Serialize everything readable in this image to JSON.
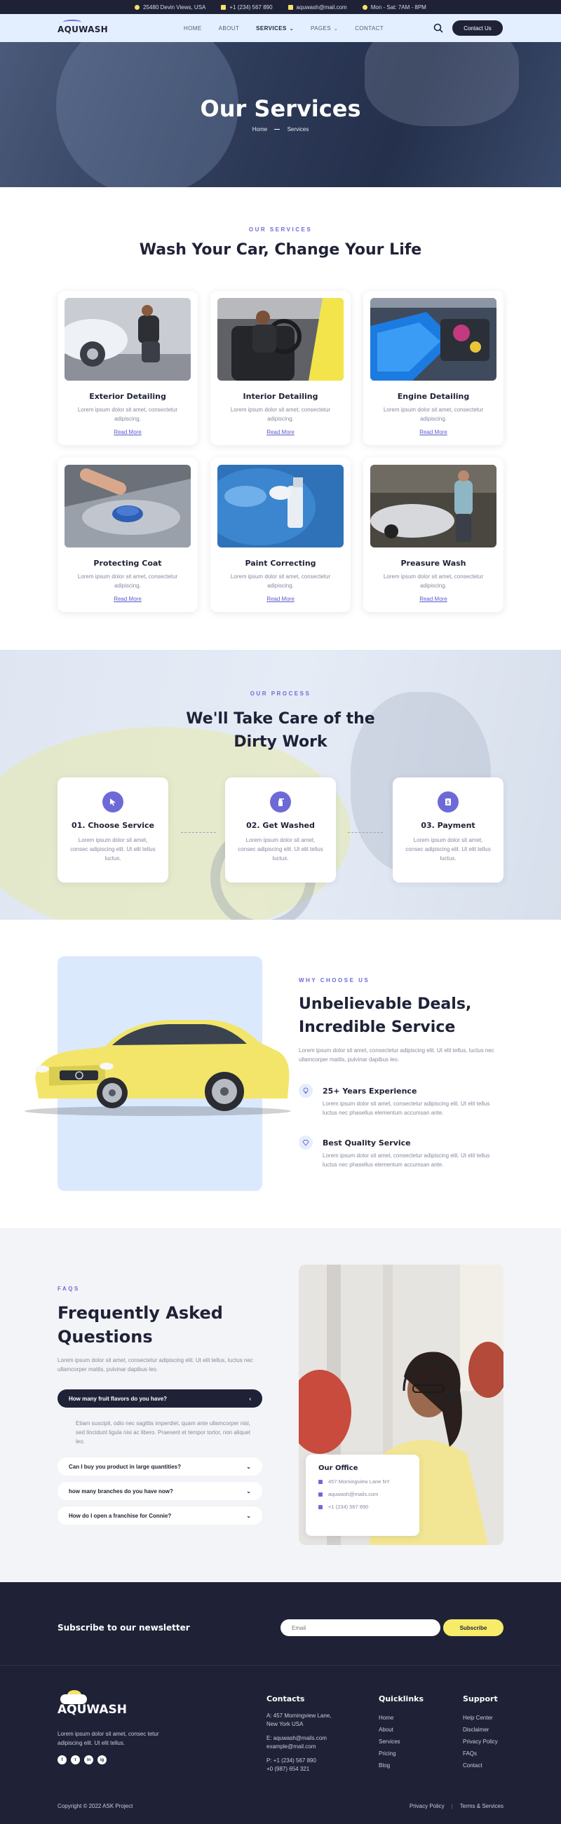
{
  "topbar": {
    "address": "25480 Devin Views, USA",
    "phone": "+1 (234) 567 890",
    "email": "aquwash@mail.com",
    "hours": "Mon - Sat: 7AM - 8PM"
  },
  "nav": {
    "logo": "AQUWASH",
    "items": [
      {
        "label": "HOME"
      },
      {
        "label": "ABOUT"
      },
      {
        "label": "SERVICES"
      },
      {
        "label": "PAGES"
      },
      {
        "label": "CONTACT"
      }
    ],
    "cta": "Contact Us"
  },
  "hero": {
    "title": "Our Services",
    "crumb_home": "Home",
    "crumb_current": "Services"
  },
  "services": {
    "eyebrow": "OUR SERVICES",
    "title": "Wash Your Car, Change Your Life",
    "cards": [
      {
        "title": "Exterior Detailing",
        "text": "Lorem ipsum dolor sit amet, consectetur adipiscing.",
        "link": "Read More"
      },
      {
        "title": "Interior Detailing",
        "text": "Lorem ipsum dolor sit amet, consectetur adipiscing.",
        "link": "Read More"
      },
      {
        "title": "Engine Detailing",
        "text": "Lorem ipsum dolor sit amet, consectetur adipiscing.",
        "link": "Read More"
      },
      {
        "title": "Protecting Coat",
        "text": "Lorem ipsum dolor sit amet, consectetur adipiscing.",
        "link": "Read More"
      },
      {
        "title": "Paint Correcting",
        "text": "Lorem ipsum dolor sit amet, consectetur adipiscing.",
        "link": "Read More"
      },
      {
        "title": "Preasure Wash",
        "text": "Lorem ipsum dolor sit amet, consectetur adipiscing.",
        "link": "Read More"
      }
    ]
  },
  "process": {
    "eyebrow": "OUR PROCESS",
    "title_line1": "We'll Take Care of the",
    "title_line2": "Dirty Work",
    "steps": [
      {
        "title": "01. Choose Service",
        "text": "Lorem ipsum dolor sit amet, consec adipiscing elit. Ut elit tellus luctus."
      },
      {
        "title": "02. Get Washed",
        "text": "Lorem ipsum dolor sit amet, consec adipiscing elit. Ut elit tellus luctus."
      },
      {
        "title": "03. Payment",
        "text": "Lorem ipsum dolor sit amet, consec adipiscing elit. Ut elit tellus luctus."
      }
    ]
  },
  "why": {
    "eyebrow": "WHY CHOOSE US",
    "title_line1": "Unbelievable Deals,",
    "title_line2": "Incredible Service",
    "lead": "Lorem ipsum dolor sit amet, consectetur adipiscing elit. Ut elit tellus, luctus nec ullamcorper mattis, pulvinar dapibus leo.",
    "features": [
      {
        "title": "25+ Years Experience",
        "text": "Lorem ipsum dolor sit amet, consectetur adipiscing elit. Ut elit tellus luctus nec phasellus elementum accumsan ante."
      },
      {
        "title": "Best Quality Service",
        "text": "Lorem ipsum dolor sit amet, consectetur adipiscing elit. Ut elit tellus luctus nec phasellus elementum accumsan ante."
      }
    ]
  },
  "faq": {
    "eyebrow": "FAQS",
    "title_line1": "Frequently Asked",
    "title_line2": "Questions",
    "lead": "Lorem ipsum dolor sit amet, consectetur adipiscing elit. Ut elit tellus, luctus nec ullamcorper mattis, pulvinar dapibus leo.",
    "items": [
      {
        "q": "How many fruit flavors do you have?"
      },
      {
        "q": "Can I buy you product in large quantities?"
      },
      {
        "q": "how many branches do you have now?"
      },
      {
        "q": "How do I open a franchise for Connie?"
      }
    ],
    "answer": "Etiam suscipit, odio nec sagittis imperdiet, quam ante ullamcorper nisl, sed tincidunt ligula nisi ac libero. Praesent et tempor tortor, non aliquet leo.",
    "office": {
      "title": "Our Office",
      "address": "457 Morningview Lane NY",
      "email": "aquwash@mails.com",
      "phone": "+1 (234) 567 890"
    }
  },
  "footer": {
    "newsletter": "Subscribe to our newsletter",
    "email_placeholder": "Email",
    "subscribe": "Subscribe",
    "logo": "AQUWASH",
    "about": "Lorem ipsum dolor sit amet, consec tetur adipiscing elit. Ut elit tellus.",
    "social": [
      "f",
      "t",
      "in",
      "ig"
    ],
    "contacts_title": "Contacts",
    "address": "A: 457 Morningview Lane, New York USA",
    "email_line1": "E: aquwash@mails.com",
    "email_line2": "example@mail.com",
    "phone_line1": "P: +1 (234) 567 890",
    "phone_line2": "+0 (987) 654 321",
    "quicklinks_title": "Quicklinks",
    "quicklinks": [
      "Home",
      "About",
      "Services",
      "Pricing",
      "Blog"
    ],
    "support_title": "Support",
    "support": [
      "Help Center",
      "Disclaimer",
      "Privacy Policy",
      "FAQs",
      "Contact"
    ],
    "copyright": "Copyright © 2022 ASK Project",
    "privacy": "Privacy Policy",
    "terms": "Terms & Services"
  }
}
